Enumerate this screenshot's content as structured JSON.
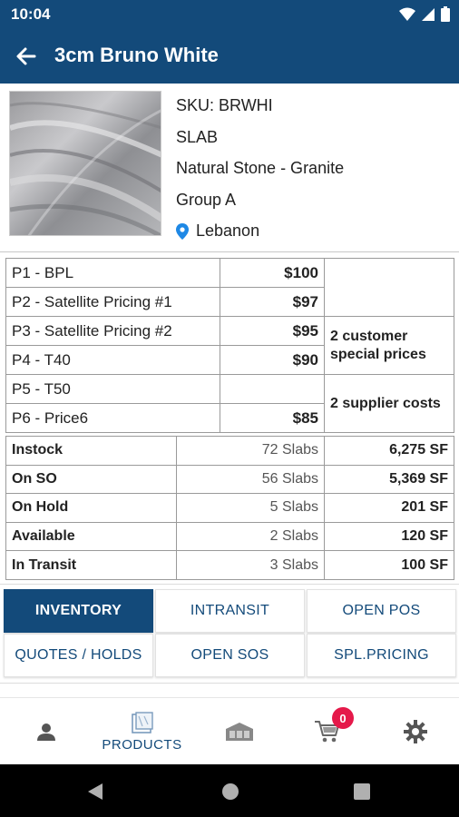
{
  "status_bar": {
    "time": "10:04"
  },
  "app_bar": {
    "title": "3cm Bruno White"
  },
  "product": {
    "sku": "SKU: BRWHI",
    "form": "SLAB",
    "category": "Natural Stone - Granite",
    "group": "Group A",
    "location": "Lebanon"
  },
  "pricing": {
    "rows": [
      {
        "label": "P1 - BPL",
        "amount": "$100"
      },
      {
        "label": "P2 - Satellite Pricing #1",
        "amount": "$97"
      },
      {
        "label": "P3 - Satellite Pricing #2",
        "amount": "$95"
      },
      {
        "label": "P4 - T40",
        "amount": "$90"
      },
      {
        "label": "P5 - T50",
        "amount": ""
      },
      {
        "label": "P6 - Price6",
        "amount": "$85"
      }
    ],
    "customer_note": "2 customer special prices",
    "supplier_note": "2 supplier costs"
  },
  "stock": {
    "rows": [
      {
        "label": "Instock",
        "slabs": "72 Slabs",
        "sf": "6,275 SF"
      },
      {
        "label": "On SO",
        "slabs": "56 Slabs",
        "sf": "5,369 SF"
      },
      {
        "label": "On Hold",
        "slabs": "5 Slabs",
        "sf": "201 SF"
      },
      {
        "label": "Available",
        "slabs": "2 Slabs",
        "sf": "120 SF"
      },
      {
        "label": "In Transit",
        "slabs": "3 Slabs",
        "sf": "100 SF"
      }
    ]
  },
  "tabs": [
    {
      "label": "INVENTORY",
      "active": true
    },
    {
      "label": "INTRANSIT",
      "active": false
    },
    {
      "label": "OPEN POS",
      "active": false
    },
    {
      "label": "QUOTES / HOLDS",
      "active": false
    },
    {
      "label": "OPEN SOS",
      "active": false
    },
    {
      "label": "SPL.PRICING",
      "active": false
    }
  ],
  "bottom_nav": {
    "products_label": "PRODUCTS",
    "cart_count": "0"
  },
  "icons": {
    "back": "arrow-left-icon",
    "location": "location-pin-icon",
    "profile": "person-icon",
    "products": "products-icon",
    "warehouse": "warehouse-icon",
    "cart": "cart-icon",
    "settings": "gear-icon"
  },
  "colors": {
    "primary": "#134a7a",
    "badge": "#e5194a",
    "pin": "#1e88e5"
  }
}
